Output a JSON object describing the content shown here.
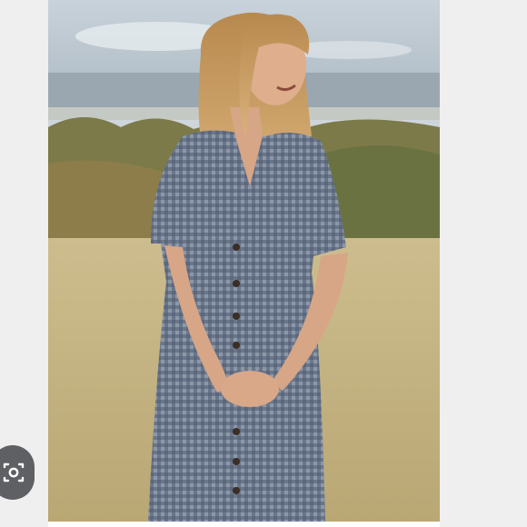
{
  "image": {
    "subject": "product-photo",
    "alt": ""
  },
  "overlay": {
    "lens_icon": "camera-lens-icon",
    "lens_color": "#5f6063"
  },
  "palette": {
    "sky": "#b9c6cf",
    "hills": "#8f9ca4",
    "shrubs": "#7a7b4e",
    "grass": "#c9b98a",
    "dress": "#6f7a8c",
    "skin": "#d9a888",
    "hair": "#c79a62"
  }
}
